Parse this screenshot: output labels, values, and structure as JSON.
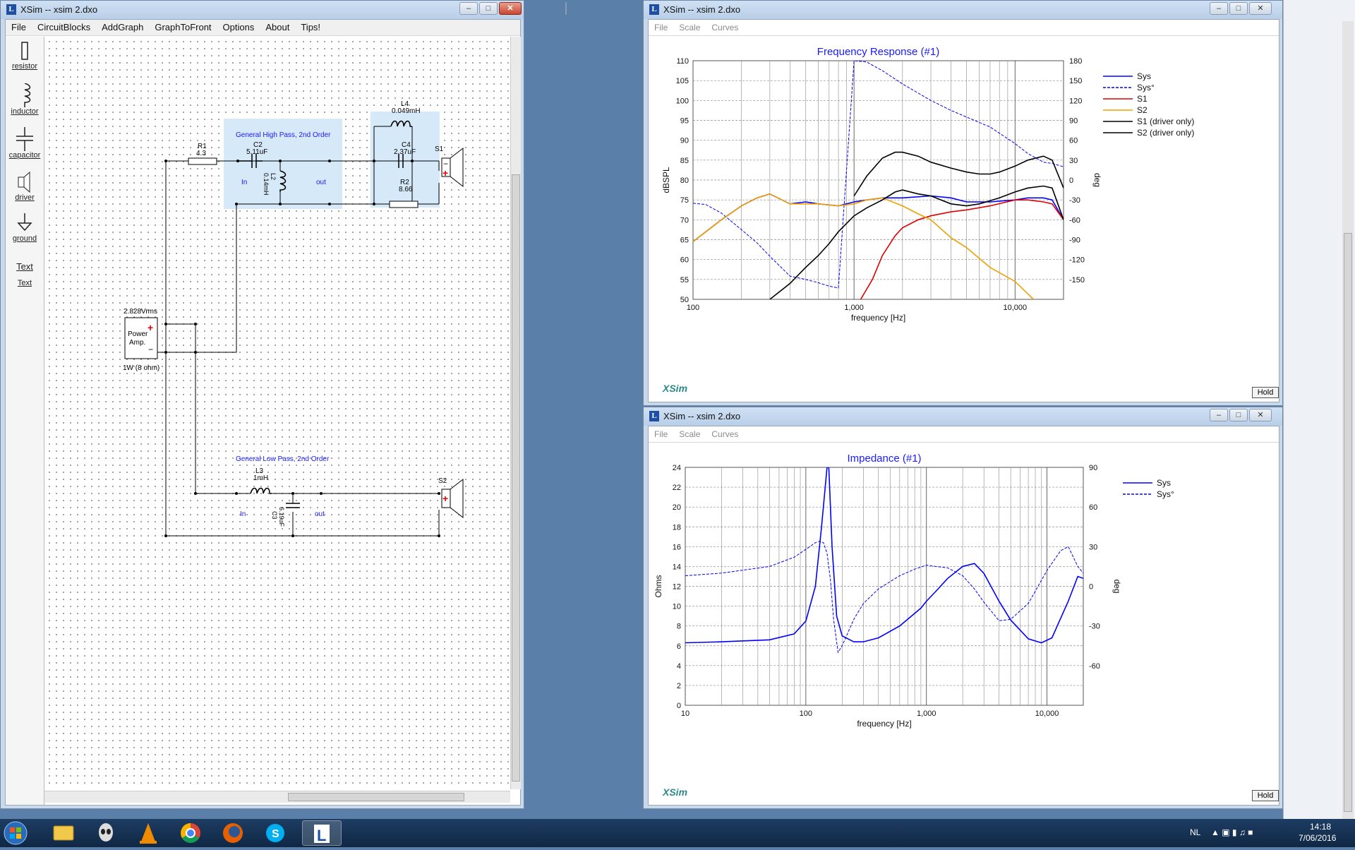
{
  "colors": {
    "sys": "#0000ff",
    "s1": "#e00000",
    "s2": "#f0a000",
    "driver": "#000000",
    "title_blue": "#1a1aff",
    "wire": "#000000",
    "block_fill": "#d6e9f8"
  },
  "circuit_window": {
    "title": "XSim -- xsim 2.dxo",
    "menu": [
      "File",
      "CircuitBlocks",
      "AddGraph",
      "GraphToFront",
      "Options",
      "About",
      "Tips!"
    ],
    "tools": [
      {
        "label": "resistor",
        "icon": "resistor-icon"
      },
      {
        "label": "inductor",
        "icon": "inductor-icon"
      },
      {
        "label": "capacitor",
        "icon": "capacitor-icon"
      },
      {
        "label": "driver",
        "icon": "driver-icon"
      },
      {
        "label": "ground",
        "icon": "ground-icon"
      },
      {
        "label": "Text",
        "icon": "text-icon"
      }
    ],
    "text_tool_glyph": "Text",
    "schematic": {
      "hp_block_title": "General High Pass, 2nd Order",
      "lp_block_title": "General Low Pass, 2nd Order",
      "r1_name": "R1",
      "r1_value": "4.3",
      "c2_name": "C2",
      "c2_value": "5.11uF",
      "l2_name": "L2",
      "l2_value": "0.14mH",
      "l4_name": "L4",
      "l4_value": "0.049mH",
      "c4_name": "C4",
      "c4_value": "2.37uF",
      "r2_name": "R2",
      "r2_value": "8.66",
      "s1_name": "S1",
      "s2_name": "S2",
      "l3_name": "L3",
      "l3_value": "1mH",
      "c3_name": "C3",
      "c3_value": "6.19uF",
      "in_label": "In",
      "out_label": "out",
      "amp_voltage": "2.828Vrms",
      "amp_line1": "Power",
      "amp_line2": "Amp.",
      "amp_rating": "1W (8 ohm)",
      "plus": "+",
      "minus": "−"
    }
  },
  "fr_window": {
    "title": "XSim -- xsim 2.dxo",
    "menu": [
      "File",
      "Scale",
      "Curves"
    ],
    "hold_label": "Hold",
    "logo": "XSim"
  },
  "imp_window": {
    "title": "XSim -- xsim 2.dxo",
    "menu": [
      "File",
      "Scale",
      "Curves"
    ],
    "hold_label": "Hold",
    "logo": "XSim"
  },
  "chart_data": [
    {
      "type": "line",
      "title": "Frequency Response (#1)",
      "xlabel": "frequency [Hz]",
      "ylabel": "dBSPL",
      "y2label": "deg",
      "x_scale": "log",
      "xlim": [
        100,
        20000
      ],
      "ylim": [
        50,
        110
      ],
      "y2lim": [
        -180,
        180
      ],
      "x_ticks": [
        {
          "v": 100,
          "t": "100"
        },
        {
          "v": 1000,
          "t": "1,000"
        },
        {
          "v": 10000,
          "t": "10,000"
        }
      ],
      "y_ticks": [
        50,
        55,
        60,
        65,
        70,
        75,
        80,
        85,
        90,
        95,
        100,
        105,
        110
      ],
      "y2_ticks": [
        -150,
        -120,
        -90,
        -60,
        -30,
        0,
        30,
        60,
        90,
        120,
        150,
        180
      ],
      "grid": true,
      "legend_position": "right",
      "series": [
        {
          "name": "Sys",
          "axis": "left",
          "style": "solid",
          "color": "#0000ff",
          "x": [
            100,
            150,
            200,
            250,
            300,
            400,
            500,
            600,
            800,
            1000,
            1200,
            1500,
            2000,
            3000,
            4000,
            5000,
            7000,
            10000,
            12000,
            15000,
            17000,
            20000
          ],
          "y": [
            64.5,
            70,
            73.5,
            75.5,
            76.5,
            74,
            74.5,
            74,
            73.5,
            74.5,
            75,
            75.5,
            75.5,
            76,
            75.5,
            74.5,
            74.5,
            75,
            75.5,
            75.5,
            75,
            70
          ]
        },
        {
          "name": "Sys°",
          "axis": "right",
          "style": "dashed",
          "color": "#0000ff",
          "x": [
            100,
            120,
            150,
            200,
            250,
            300,
            400,
            500,
            600,
            700,
            800,
            1000,
            1200,
            1500,
            2000,
            3000,
            4000,
            5000,
            7000,
            10000,
            12000,
            15000,
            17000,
            20000
          ],
          "y": [
            -35,
            -37,
            -50,
            -75,
            -95,
            -115,
            -145,
            -150,
            -155,
            -160,
            -163,
            180,
            178,
            165,
            145,
            120,
            105,
            95,
            80,
            55,
            40,
            27,
            25,
            20
          ]
        },
        {
          "name": "S1",
          "axis": "left",
          "style": "solid",
          "color": "#e00000",
          "x": [
            1100,
            1300,
            1500,
            1800,
            2000,
            2500,
            3000,
            4000,
            5000,
            7000,
            10000,
            12000,
            15000,
            17000,
            20000
          ],
          "y": [
            50,
            55,
            61,
            66,
            68,
            70,
            71,
            72,
            72.5,
            73.5,
            75,
            75,
            74.5,
            74,
            70
          ]
        },
        {
          "name": "S2",
          "axis": "left",
          "style": "solid",
          "color": "#f0a000",
          "x": [
            100,
            150,
            200,
            250,
            300,
            400,
            500,
            600,
            800,
            1000,
            1200,
            1500,
            2000,
            2500,
            3000,
            4000,
            5000,
            7000,
            10000,
            13000
          ],
          "y": [
            64.5,
            70,
            73.5,
            75.5,
            76.5,
            74,
            74,
            74,
            73.5,
            74,
            75,
            75.5,
            73.5,
            71.5,
            70,
            65.5,
            63,
            58,
            54.5,
            50
          ]
        },
        {
          "name": "S1 (driver only)",
          "axis": "left",
          "style": "solid",
          "color": "#000000",
          "x": [
            300,
            400,
            500,
            600,
            700,
            800,
            1000,
            1200,
            1500,
            1800,
            2000,
            2500,
            3000,
            4000,
            5000,
            6000,
            8000,
            10000,
            12000,
            15000,
            17000,
            20000
          ],
          "y": [
            50,
            54,
            58,
            61,
            64,
            67,
            71,
            73,
            75,
            77,
            77.5,
            76.5,
            76,
            74,
            73.5,
            74,
            75.5,
            77,
            78,
            78.5,
            78,
            70
          ]
        },
        {
          "name": "S2 (driver only)",
          "axis": "left",
          "style": "solid",
          "color": "#000000",
          "x": [
            1000,
            1200,
            1500,
            1800,
            2000,
            2500,
            3000,
            4000,
            5000,
            6000,
            7000,
            8000,
            10000,
            12000,
            15000,
            17000,
            20000
          ],
          "y": [
            76,
            81,
            85.5,
            87,
            87,
            86,
            84.5,
            83,
            82,
            81.5,
            81.5,
            82,
            83.5,
            85,
            86,
            85,
            78
          ]
        }
      ]
    },
    {
      "type": "line",
      "title": "Impedance (#1)",
      "xlabel": "frequency [Hz]",
      "ylabel": "Ohms",
      "y2label": "deg",
      "x_scale": "log",
      "xlim": [
        10,
        20000
      ],
      "ylim": [
        0,
        24
      ],
      "y2lim": [
        -90,
        90
      ],
      "x_ticks": [
        {
          "v": 10,
          "t": "10"
        },
        {
          "v": 100,
          "t": "100"
        },
        {
          "v": 1000,
          "t": "1,000"
        },
        {
          "v": 10000,
          "t": "10,000"
        }
      ],
      "y_ticks": [
        0,
        2,
        4,
        6,
        8,
        10,
        12,
        14,
        16,
        18,
        20,
        22,
        24
      ],
      "y2_ticks": [
        -60,
        -30,
        0,
        30,
        60,
        90
      ],
      "grid": true,
      "legend_position": "right",
      "series": [
        {
          "name": "Sys",
          "axis": "left",
          "style": "solid",
          "color": "#0000ff",
          "x": [
            10,
            20,
            50,
            80,
            100,
            120,
            135,
            150,
            155,
            165,
            180,
            200,
            250,
            300,
            400,
            600,
            900,
            1000,
            1200,
            1500,
            2000,
            2500,
            3000,
            4000,
            5000,
            7000,
            9000,
            11000,
            15000,
            18000,
            20000
          ],
          "y": [
            6.3,
            6.4,
            6.6,
            7.2,
            8.5,
            12,
            18,
            24,
            24,
            16,
            9,
            7,
            6.4,
            6.4,
            6.8,
            8,
            9.8,
            10.5,
            11.5,
            12.8,
            14,
            14.3,
            13.3,
            10.5,
            8.6,
            6.7,
            6.3,
            6.8,
            10.5,
            13,
            12.8
          ]
        },
        {
          "name": "Sys°",
          "axis": "right",
          "style": "dashed",
          "color": "#0000ff",
          "x": [
            10,
            20,
            50,
            80,
            100,
            120,
            130,
            140,
            150,
            160,
            170,
            185,
            200,
            250,
            300,
            400,
            600,
            800,
            1000,
            1200,
            1500,
            2000,
            2500,
            3000,
            4000,
            5000,
            7000,
            10000,
            13000,
            15000,
            18000,
            20000
          ],
          "y": [
            8,
            10,
            15,
            22,
            28,
            33,
            34,
            33,
            25,
            5,
            -25,
            -50,
            -45,
            -25,
            -13,
            -2,
            8,
            13,
            16,
            15,
            14,
            8,
            -2,
            -12,
            -26,
            -25,
            -13,
            12,
            27,
            30,
            15,
            10
          ]
        }
      ]
    }
  ]
}
